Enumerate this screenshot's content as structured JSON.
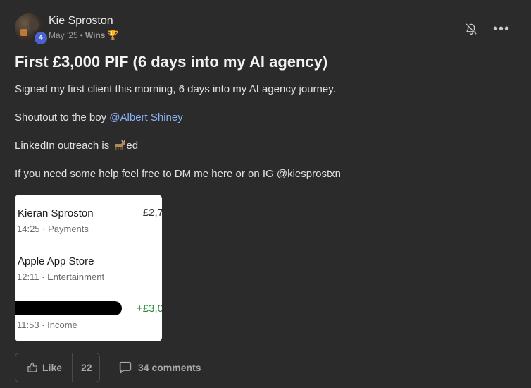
{
  "post": {
    "author": "Kie Sproston",
    "level": "4",
    "date": "May '25",
    "separator": "•",
    "category": "Wins",
    "title": "First £3,000 PIF (6 days into my AI agency)",
    "body": {
      "line1": "Signed my first client this morning, 6 days into my AI agency journey.",
      "line2_prefix": "Shoutout to the boy ",
      "line2_mention": "@Albert Shiney",
      "line3_prefix": "LinkedIn outreach is ",
      "line3_suffix": "ed",
      "line4": "If you need some help feel free to DM me here or on IG @kiesprostxn"
    }
  },
  "transactions": [
    {
      "name": "Kieran Sproston",
      "sub": "14:25 · Payments",
      "amount": "£2,7"
    },
    {
      "name": "Apple App Store",
      "sub": "12:11 · Entertainment",
      "amount": ""
    },
    {
      "name": "",
      "sub": "11:53 · Income",
      "amount": "+£3,0"
    }
  ],
  "actions": {
    "like_label": "Like",
    "like_count": "22",
    "comments_label": "34 comments"
  },
  "icons": {
    "bell": "bell-off-icon",
    "more": "more-horizontal-icon",
    "trophy": "trophy-icon",
    "goat": "goat-emoji-icon",
    "like": "thumbs-up-icon",
    "comment": "comment-icon"
  },
  "colors": {
    "background": "#2b2b2b",
    "mention": "#8ab4f8",
    "badge": "#4a62c9",
    "positive_amount": "#2e8b3a"
  }
}
